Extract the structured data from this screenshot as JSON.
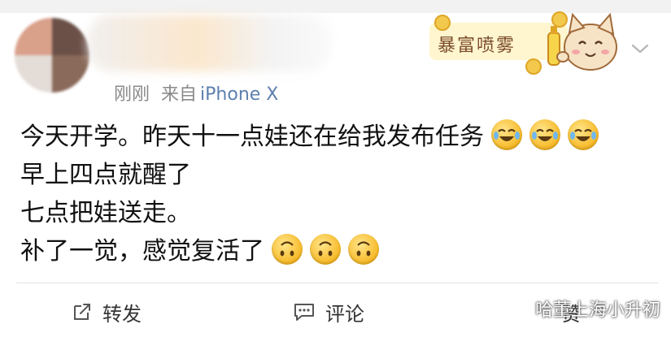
{
  "post": {
    "time": "刚刚",
    "source_prefix": "来自",
    "source_device": "iPhone X",
    "sticker_text": "暴富喷雾",
    "lines": [
      "今天开学。昨天十一点娃还在给我发布任务",
      "早上四点就醒了",
      "七点把娃送走。",
      "补了一觉，感觉复活了"
    ],
    "line1_emojis": [
      "laugh-cry-emoji",
      "laugh-cry-emoji",
      "laugh-cry-emoji"
    ],
    "line4_emojis": [
      "upside-down-face-emoji",
      "upside-down-face-emoji",
      "upside-down-face-emoji"
    ]
  },
  "actions": {
    "repost_label": "转发",
    "comment_label": "评论",
    "like_label": "赞"
  },
  "watermark": {
    "text": "哈董上海小升初"
  },
  "colors": {
    "link": "#5c7fae",
    "meta": "#8a8a8a",
    "emoji": "#f6b51e"
  }
}
